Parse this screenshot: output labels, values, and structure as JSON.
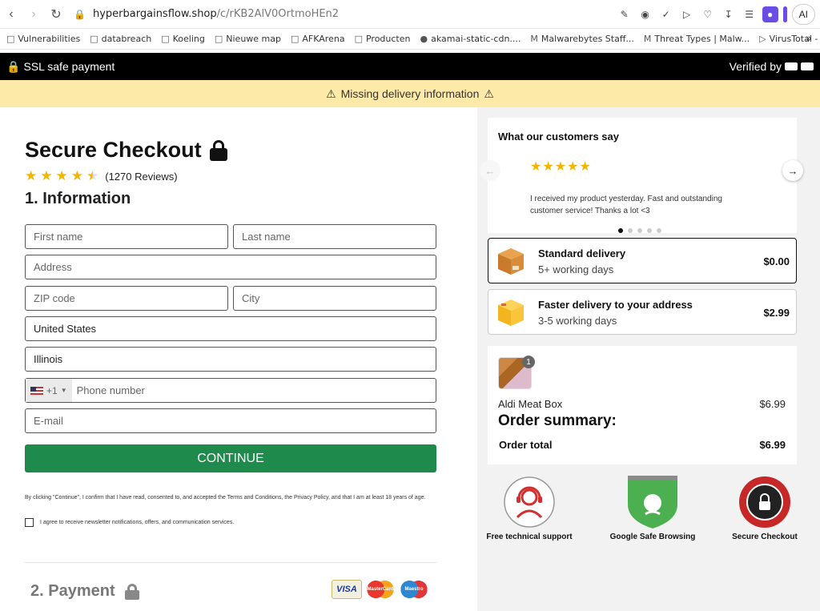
{
  "browser": {
    "url_host": "hyperbargainsflow.shop",
    "url_path": "/c/rKB2AlV0OrtmoHEn2",
    "ai_label": "AI"
  },
  "bookmarks": [
    {
      "label": "Vulnerabilities",
      "icon": "folder-icon"
    },
    {
      "label": "databreach",
      "icon": "folder-icon"
    },
    {
      "label": "Koeling",
      "icon": "folder-icon"
    },
    {
      "label": "Nieuwe map",
      "icon": "folder-icon"
    },
    {
      "label": "AFKArena",
      "icon": "folder-icon"
    },
    {
      "label": "Producten",
      "icon": "folder-icon"
    },
    {
      "label": "akamai-static-cdn....",
      "icon": "avatar-icon"
    },
    {
      "label": "Malwarebytes Staff...",
      "icon": "malwarebytes-icon"
    },
    {
      "label": "Threat Types | Malw...",
      "icon": "malwarebytes-icon"
    },
    {
      "label": "VirusTotal - Home",
      "icon": "virustotal-icon"
    }
  ],
  "ssl_bar": {
    "left_text": "SSL safe payment",
    "right_text": "Verified by"
  },
  "warning": {
    "text": "Missing delivery information"
  },
  "checkout": {
    "title": "Secure Checkout",
    "reviews": "(1270 Reviews)",
    "rating": 4.5,
    "section_info": "1. Information",
    "fields": {
      "first_name": "First name",
      "last_name": "Last name",
      "address": "Address",
      "zip": "ZIP code",
      "city": "City",
      "country": "United States",
      "state": "Illinois",
      "phone_code": "+1",
      "phone": "Phone number",
      "email": "E-mail"
    },
    "continue_label": "CONTINUE",
    "legal": "By clicking \"Continue\", I confirm that I have read, consented to, and accepted the Terms and Conditions, the Privacy Policy, and that I am at least 18 years of age.",
    "newsletter": "I agree to receive newsletter notifications, offers, and communication services.",
    "section_payment": "2. Payment",
    "payment_logos": [
      "VISA",
      "MasterCard",
      "Maestro"
    ]
  },
  "testimonials": {
    "title": "What our customers say",
    "stars": "★★★★★",
    "text": "I received my product yesterday. Fast and outstanding customer service! Thanks a lot <3",
    "dots": 5,
    "active_dot": 0
  },
  "shipping": [
    {
      "title": "Standard delivery",
      "sub": "5+ working days",
      "price": "$0.00",
      "selected": true
    },
    {
      "title": "Faster delivery to your address",
      "sub": "3-5 working days",
      "price": "$2.99",
      "selected": false
    }
  ],
  "summary": {
    "qty": "1",
    "product": "Aldi Meat Box",
    "product_price": "$6.99",
    "title": "Order summary:",
    "total_label": "Order total",
    "total_value": "$6.99"
  },
  "trust": [
    {
      "label": "Free technical support",
      "icon": "support-agent-icon"
    },
    {
      "label": "Google Safe Browsing",
      "icon": "safe-browsing-shield-icon"
    },
    {
      "label": "Secure Checkout",
      "icon": "secure-checkout-seal-icon"
    }
  ],
  "colors": {
    "continue": "#1e8a4c",
    "warning_bg": "#fde9a8",
    "star": "#f5b400"
  }
}
